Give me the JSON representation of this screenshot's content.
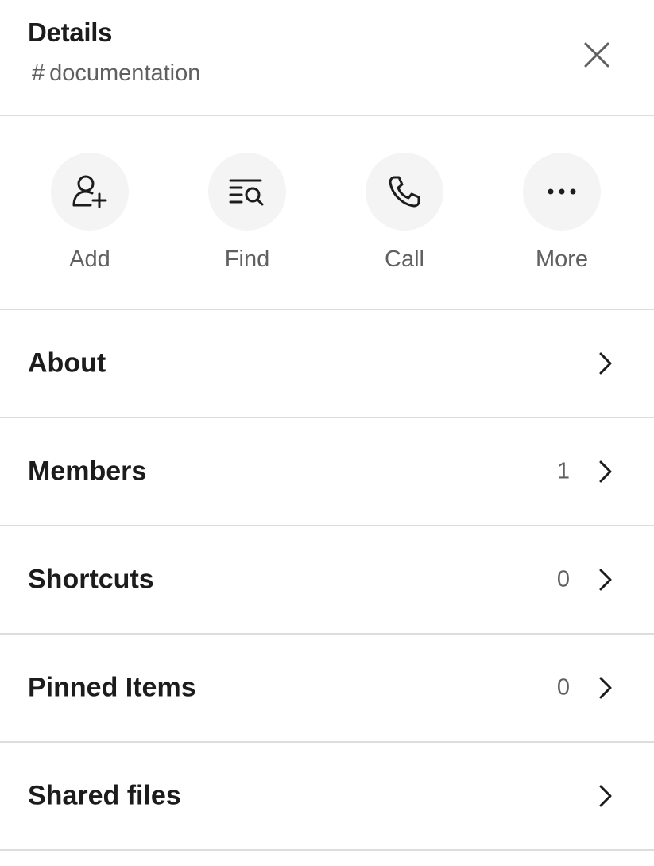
{
  "header": {
    "title": "Details",
    "channel_prefix": "#",
    "channel_name": "documentation"
  },
  "actions": [
    {
      "label": "Add",
      "icon": "add-person-icon"
    },
    {
      "label": "Find",
      "icon": "find-in-channel-icon"
    },
    {
      "label": "Call",
      "icon": "phone-icon"
    },
    {
      "label": "More",
      "icon": "more-horizontal-icon"
    }
  ],
  "rows": [
    {
      "label": "About",
      "count": null
    },
    {
      "label": "Members",
      "count": "1"
    },
    {
      "label": "Shortcuts",
      "count": "0"
    },
    {
      "label": "Pinned Items",
      "count": "0"
    },
    {
      "label": "Shared files",
      "count": null
    }
  ]
}
